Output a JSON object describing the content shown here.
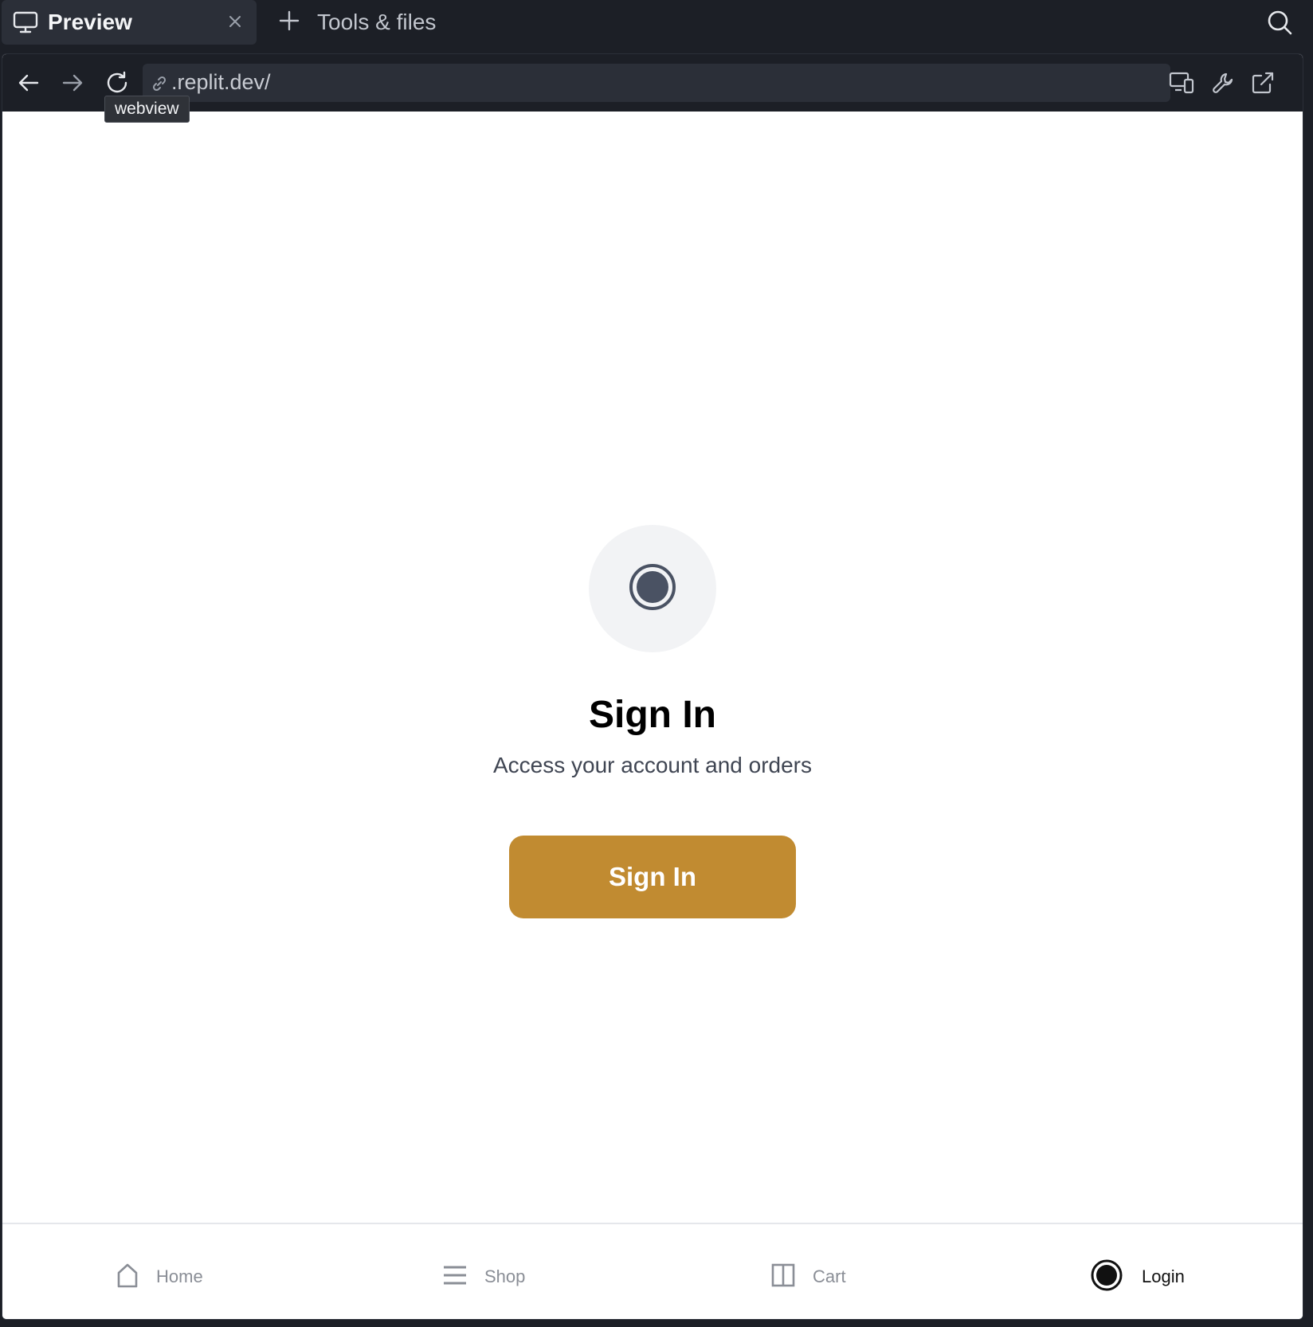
{
  "tabs": {
    "preview_label": "Preview",
    "tools_label": "Tools & files"
  },
  "toolbar": {
    "url": ".replit.dev/",
    "tooltip": "webview"
  },
  "signin": {
    "title": "Sign In",
    "subtitle": "Access your account and orders",
    "button_label": "Sign In",
    "button_color": "#c18b31"
  },
  "bottom_nav": {
    "items": [
      {
        "label": "Home",
        "icon": "home-icon"
      },
      {
        "label": "Shop",
        "icon": "menu-icon"
      },
      {
        "label": "Cart",
        "icon": "columns-icon"
      },
      {
        "label": "Login",
        "icon": "record-circle-icon",
        "active": true
      }
    ]
  }
}
